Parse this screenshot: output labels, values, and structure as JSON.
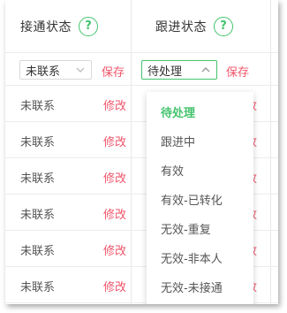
{
  "headers": {
    "status_title": "接通状态",
    "followup_title": "跟进状态",
    "help_glyph": "?"
  },
  "filters": {
    "status_select": "未联系",
    "status_save": "保存",
    "followup_select": "待处理",
    "followup_save": "保存"
  },
  "rows": [
    {
      "status": "未联系",
      "edit": "修改",
      "edit_right": "改"
    },
    {
      "status": "未联系",
      "edit": "修改",
      "edit_right": "改"
    },
    {
      "status": "未联系",
      "edit": "修改",
      "edit_right": "改"
    },
    {
      "status": "未联系",
      "edit": "修改",
      "edit_right": "改"
    },
    {
      "status": "未联系",
      "edit": "修改",
      "edit_right": "改"
    },
    {
      "status": "未联系",
      "edit": "修改",
      "edit_right": "改"
    }
  ],
  "dropdown_options": [
    {
      "label": "待处理",
      "selected": true
    },
    {
      "label": "跟进中",
      "selected": false
    },
    {
      "label": "有效",
      "selected": false
    },
    {
      "label": "有效-已转化",
      "selected": false
    },
    {
      "label": "无效-重复",
      "selected": false
    },
    {
      "label": "无效-非本人",
      "selected": false
    },
    {
      "label": "无效-未接通",
      "selected": false
    }
  ],
  "colors": {
    "accent_green": "#44c36d",
    "action_red": "#f0556b"
  }
}
